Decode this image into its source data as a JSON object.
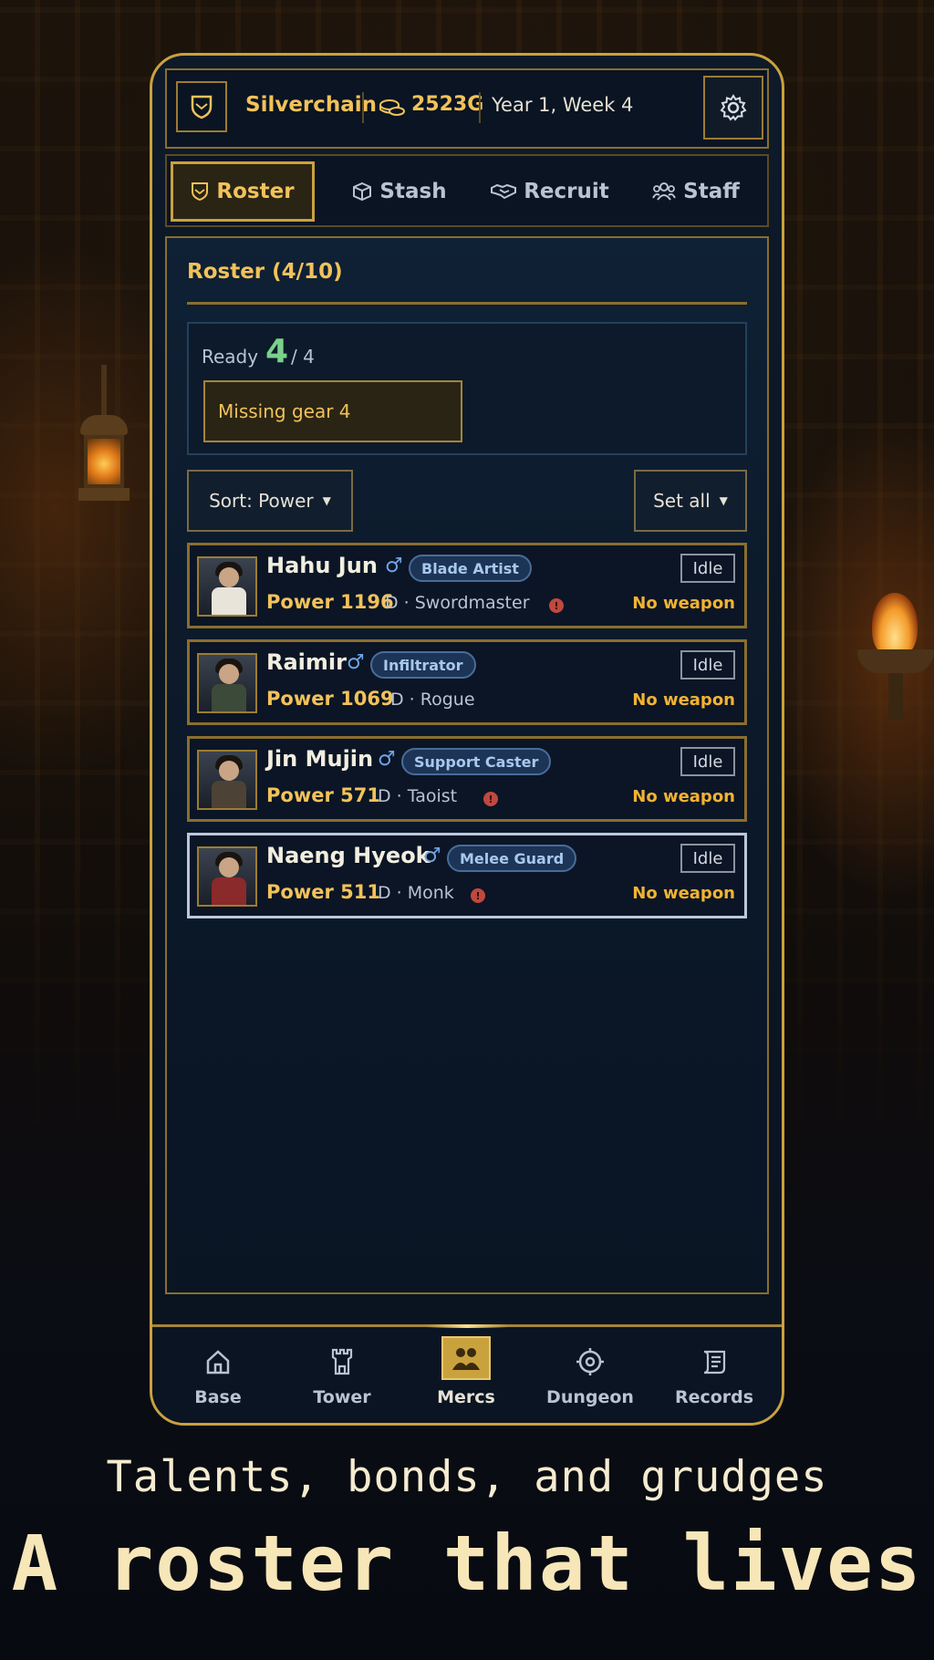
{
  "topbar": {
    "guild_name": "Silverchain",
    "gold": "2523G",
    "date": "Year 1, Week 4",
    "icons": {
      "guild": "shield-icon",
      "gold": "coin-icon",
      "settings": "gear-icon"
    }
  },
  "tabs": [
    {
      "label": "Roster",
      "icon": "shield-icon",
      "active": true
    },
    {
      "label": "Stash",
      "icon": "box-icon",
      "active": false
    },
    {
      "label": "Recruit",
      "icon": "handshake-icon",
      "active": false
    },
    {
      "label": "Staff",
      "icon": "people-icon",
      "active": false
    }
  ],
  "roster": {
    "title": "Roster (4/10)",
    "ready_label": "Ready",
    "ready_count": "4",
    "ready_total": "/ 4",
    "missing_gear": "Missing gear 4",
    "sort_label": "Sort: Power",
    "set_all_label": "Set all",
    "mercs": [
      {
        "name": "Hahu Jun",
        "gender": "♂",
        "class": "Blade Artist",
        "status": "Idle",
        "power": "Power 1196",
        "rank_job": "D · Swordmaster",
        "warning": true,
        "weapon": "No weapon",
        "selected": false
      },
      {
        "name": "Raimir",
        "gender": "♂",
        "class": "Infiltrator",
        "status": "Idle",
        "power": "Power 1069",
        "rank_job": "D · Rogue",
        "warning": false,
        "weapon": "No weapon",
        "selected": false
      },
      {
        "name": "Jin Mujin",
        "gender": "♂",
        "class": "Support Caster",
        "status": "Idle",
        "power": "Power 571",
        "rank_job": "D · Taoist",
        "warning": true,
        "weapon": "No weapon",
        "selected": false
      },
      {
        "name": "Naeng Hyeok",
        "gender": "♂",
        "class": "Melee Guard",
        "status": "Idle",
        "power": "Power 511",
        "rank_job": "D · Monk",
        "warning": true,
        "weapon": "No weapon",
        "selected": true
      }
    ]
  },
  "bottom_nav": [
    {
      "label": "Base",
      "icon": "home-icon",
      "active": false
    },
    {
      "label": "Tower",
      "icon": "tower-icon",
      "active": false
    },
    {
      "label": "Mercs",
      "icon": "mercs-icon",
      "active": true
    },
    {
      "label": "Dungeon",
      "icon": "target-icon",
      "active": false
    },
    {
      "label": "Records",
      "icon": "scroll-icon",
      "active": false
    }
  ],
  "promo": {
    "tagline": "Talents, bonds, and grudges",
    "headline": "A roster that lives"
  },
  "colors": {
    "accent_gold": "#f2c25a",
    "ready_green": "#7bd18a",
    "class_badge_blue": "#1c3456",
    "warning_red": "#c0483f",
    "no_weapon_orange": "#f2b332"
  }
}
